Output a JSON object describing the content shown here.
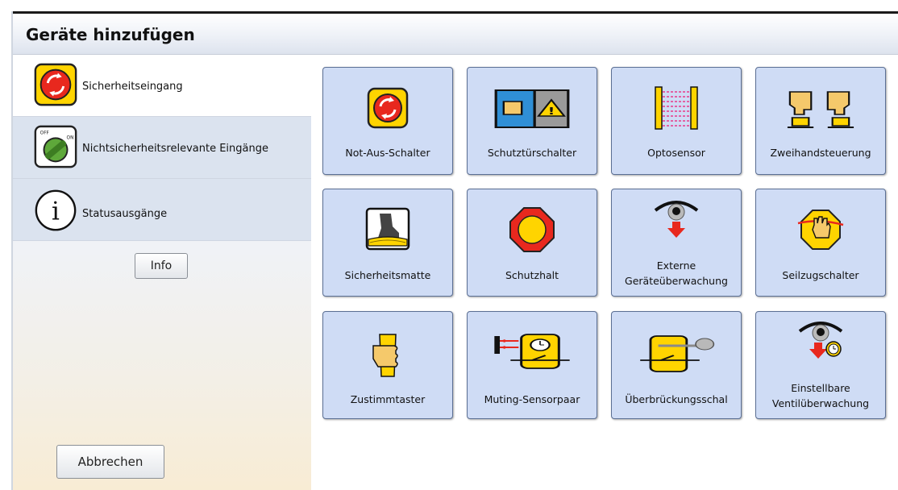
{
  "window": {
    "title": "Geräte hinzufügen"
  },
  "sidebar": {
    "categories": [
      {
        "label": "Sicherheitseingang",
        "icon": "emergency-stop-icon",
        "selected": true
      },
      {
        "label": "Nichtsicherheitsrelevante Eingänge",
        "icon": "off-on-switch-icon",
        "selected": false
      },
      {
        "label": "Statusausgänge",
        "icon": "info-circle-icon",
        "selected": false
      }
    ],
    "info_button": "Info",
    "cancel_button": "Abbrechen"
  },
  "devices": [
    {
      "label": "Not-Aus-Schalter",
      "icon": "emergency-stop-icon"
    },
    {
      "label": "Schutztürschalter",
      "icon": "safety-door-switch-icon"
    },
    {
      "label": "Optosensor",
      "icon": "light-curtain-icon"
    },
    {
      "label": "Zweihandsteuerung",
      "icon": "two-hand-control-icon"
    },
    {
      "label": "Sicherheitsmatte",
      "icon": "safety-mat-icon"
    },
    {
      "label": "Schutzhalt",
      "icon": "protective-stop-icon"
    },
    {
      "label": "Externe Geräteüberwachung",
      "line1": "Externe",
      "line2": "Geräteüberwachung",
      "icon": "external-device-monitoring-icon"
    },
    {
      "label": "Seilzugschalter",
      "icon": "rope-pull-switch-icon"
    },
    {
      "label": "Zustimmtaster",
      "icon": "enabling-switch-icon"
    },
    {
      "label": "Muting-Sensorpaar",
      "icon": "muting-sensor-pair-icon"
    },
    {
      "label": "Überbrückungsschal",
      "icon": "bypass-switch-icon"
    },
    {
      "label": "Einstellbare Ventilüberwachung",
      "line1": "Einstellbare",
      "line2": "Ventilüberwachung",
      "icon": "adjustable-valve-monitoring-icon"
    }
  ],
  "colors": {
    "tile_bg": "#cfdcf5",
    "tile_border": "#5b6f94",
    "emergency_red": "#e8281e",
    "icon_yellow": "#ffd400"
  }
}
